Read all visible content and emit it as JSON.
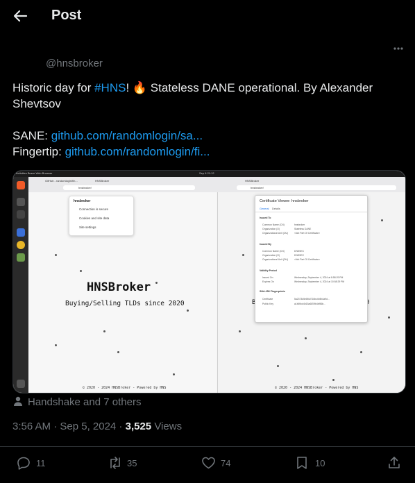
{
  "header": {
    "title": "Post"
  },
  "author": {
    "handle": "@hnsbroker"
  },
  "tweet": {
    "line1_pre": "Historic day for ",
    "line1_hashtag": "#HNS",
    "line1_post": "! 🔥 Stateless DANE operational. By Alexander",
    "line2": "Shevtsov",
    "sane_label": "SANE: ",
    "sane_link": "github.com/randomlogin/sa...",
    "fingertip_label": "Fingertip: ",
    "fingertip_link": "github.com/randomlogin/fi..."
  },
  "media": {
    "topbar_left": "Activities   Brave Web Browser",
    "topbar_center": "Sep 6  21:12",
    "tab_left_1": "GitHub - randomlogin/fin...",
    "tab_left_2": "HNSBroker",
    "tab_right": "HNSBroker",
    "url_left": "hnsbroker/",
    "url_right": "hnsbroker/",
    "popup_title": "hnsbroker",
    "popup_items": [
      "Connection is secure",
      "Cookies and site data",
      "Site settings"
    ],
    "brand": "HNSBroker",
    "tagline": "Buying/Selling TLDs since 2020",
    "footer": "© 2020 - 2024 HNSBroker - Powered by HNS",
    "cert_title": "Certificate Viewer: hnsbroker",
    "cert_tabs": [
      "General",
      "Details"
    ],
    "cert_issued_to": "Issued To",
    "cert_issued_by": "Issued By",
    "cert_validity": "Validity Period",
    "cert_fingerprints": "SHA-256 Fingerprints",
    "cert_rows_to": [
      [
        "Common Name (CN)",
        "hnsbroker"
      ],
      [
        "Organization (O)",
        "Stateless DANE"
      ],
      [
        "Organizational Unit (OU)",
        "<Not Part Of Certificate>"
      ]
    ],
    "cert_rows_by": [
      [
        "Common Name (CN)",
        "DNSSEC"
      ],
      [
        "Organization (O)",
        "DNSSEC"
      ],
      [
        "Organizational Unit (OU)",
        "<Not Part Of Certificate>"
      ]
    ],
    "cert_rows_valid": [
      [
        "Issued On",
        "Wednesday, September 4, 2024 at 8:58:29 PM"
      ],
      [
        "Expires On",
        "Wednesday, September 4, 2024 at 10:58:29 PM"
      ]
    ],
    "cert_rows_fp": [
      [
        "Certificate",
        "5a2373d5e8f4d716bc4b5b4a9d..."
      ],
      [
        "Public Key",
        "a1b69cd4b15a6f20fb4bf56b..."
      ]
    ]
  },
  "likers": {
    "text": "Handshake and 7 others"
  },
  "meta": {
    "time": "3:56 AM · Sep 5, 2024 · ",
    "views_count": "3,525",
    "views_label": " Views"
  },
  "actions": {
    "replies": "11",
    "reposts": "35",
    "likes": "74",
    "bookmarks": "10"
  },
  "colors": {
    "background": "#000000",
    "text": "#e7e9ea",
    "muted": "#71767b",
    "link": "#1d9bf0"
  }
}
